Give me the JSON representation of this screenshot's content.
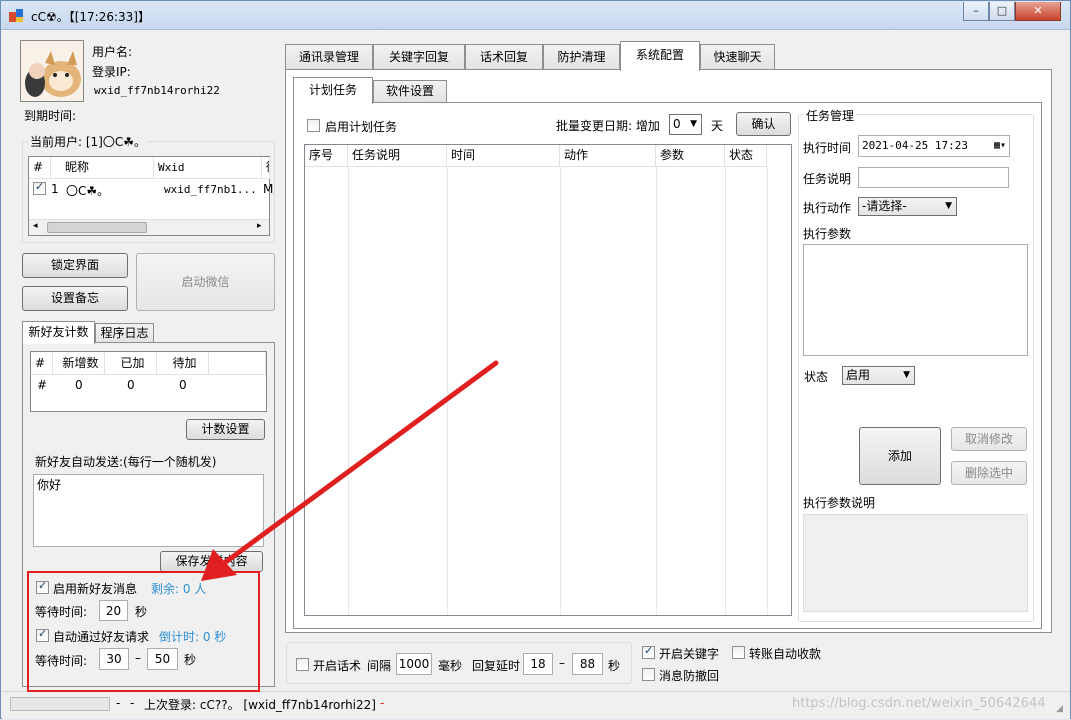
{
  "window": {
    "title": "cC☢。【[17:26:33]】",
    "min_label": "–",
    "max_label": "□",
    "close_label": "✕"
  },
  "profile": {
    "username_label": "用户名:",
    "ip_label": "登录IP:",
    "wxid": "wxid_ff7nb14rorhi22",
    "expire_label": "到期时间:"
  },
  "current_user": {
    "label": "当前用户: [1]〇C☘。",
    "headers": [
      "#",
      "昵称",
      "Wxid",
      "微"
    ],
    "rows": [
      {
        "checked": true,
        "num": "1",
        "nick": "〇C☘。",
        "wxid": "wxid_ff7nb1...",
        "extra": "M"
      }
    ]
  },
  "left_buttons": {
    "lock": "锁定界面",
    "backup": "设置备忘",
    "start_wechat": "启动微信"
  },
  "left_tabs": [
    "新好友计数",
    "程序日志"
  ],
  "counter": {
    "headers": [
      "#",
      "新增数",
      "已加",
      "待加"
    ],
    "row": [
      "#",
      "0",
      "0",
      "0"
    ],
    "settings_button": "计数设置"
  },
  "auto_send": {
    "label": "新好友自动发送:(每行一个随机发)",
    "text": "你好",
    "save_button": "保存发送内容"
  },
  "new_friend_msg": {
    "label": "启用新好友消息",
    "remain": "剩余: 0 人",
    "wait_label": "等待时间:",
    "wait": "20",
    "unit": "秒"
  },
  "auto_accept": {
    "label": "自动通过好友请求",
    "countdown": "倒计时: 0 秒",
    "wait_label": "等待时间:",
    "min": "30",
    "dash": "–",
    "max": "50",
    "unit": "秒"
  },
  "main_tabs": [
    "通讯录管理",
    "关键字回复",
    "话术回复",
    "防护清理",
    "系统配置",
    "快速聊天"
  ],
  "sub_tabs": [
    "计划任务",
    "软件设置"
  ],
  "plan": {
    "enable_label": "启用计划任务",
    "batch_label": "批量变更日期: 增加",
    "batch_value": "0",
    "day": "天",
    "confirm": "确认",
    "headers": [
      "序号",
      "任务说明",
      "时间",
      "动作",
      "参数",
      "状态"
    ]
  },
  "task_mgr": {
    "title": "任务管理",
    "exec_time_label": "执行时间",
    "exec_time": "2021-04-25 17:23",
    "desc_label": "任务说明",
    "action_label": "执行动作",
    "action_value": "-请选择-",
    "param_label": "执行参数",
    "status_label": "状态",
    "status_value": "启用",
    "add": "添加",
    "cancel_edit": "取消修改",
    "delete_sel": "删除选中",
    "param_desc_label": "执行参数说明"
  },
  "bottom": {
    "script_label": "开启话术",
    "interval_label": "间隔",
    "interval": "1000",
    "ms": "毫秒",
    "delay_label": "回复延时",
    "delay_min": "18",
    "dash": "–",
    "delay_max": "88",
    "sec": "秒",
    "keyword_label": "开启关键字",
    "transfer_label": "转账自动收款",
    "anti_recall_label": "消息防撤回"
  },
  "status": {
    "dash1": "-",
    "dash2": "-",
    "last_login": "上次登录: cC??。 [wxid_ff7nb14rorhi22]",
    "dash3": "-",
    "watermark": "https://blog.csdn.net/weixin_50642644"
  },
  "colors": {
    "accent_blue": "#2e8fd6",
    "annotation_red": "#e02020"
  }
}
